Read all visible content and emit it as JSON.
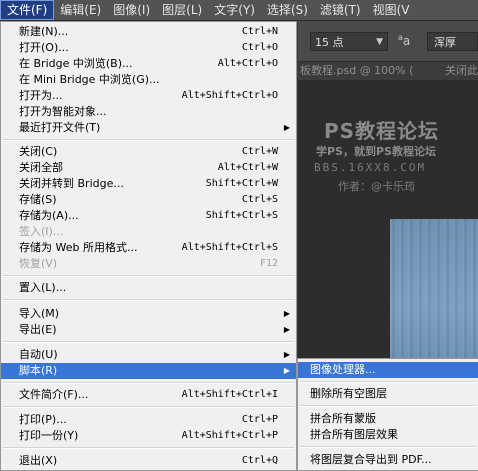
{
  "menubar": {
    "items": [
      "文件(F)",
      "编辑(E)",
      "图像(I)",
      "图层(L)",
      "文字(Y)",
      "选择(S)",
      "滤镜(T)",
      "视图(V"
    ]
  },
  "options": {
    "font_size": "15 点",
    "aa_icon": "a",
    "aa_sub": "a",
    "aa_value": "浑厚"
  },
  "doc_tab": {
    "title": "板教程.psd @ 100% (",
    "close_text": "关闭此"
  },
  "watermark": {
    "title": "PS教程论坛",
    "subtitle": "学PS，就到PS教程论坛",
    "url": "BBS.16XX8.COM",
    "author": "作者：@卡乐筠"
  },
  "file_menu": {
    "items": [
      {
        "label": "新建(N)...",
        "shortcut": "Ctrl+N"
      },
      {
        "label": "打开(O)...",
        "shortcut": "Ctrl+O"
      },
      {
        "label": "在 Bridge 中浏览(B)...",
        "shortcut": "Alt+Ctrl+O"
      },
      {
        "label": "在 Mini Bridge 中浏览(G)...",
        "shortcut": ""
      },
      {
        "label": "打开为...",
        "shortcut": "Alt+Shift+Ctrl+O"
      },
      {
        "label": "打开为智能对象...",
        "shortcut": ""
      },
      {
        "label": "最近打开文件(T)",
        "shortcut": ""
      },
      {
        "label": "关闭(C)",
        "shortcut": "Ctrl+W"
      },
      {
        "label": "关闭全部",
        "shortcut": "Alt+Ctrl+W"
      },
      {
        "label": "关闭并转到 Bridge...",
        "shortcut": "Shift+Ctrl+W"
      },
      {
        "label": "存储(S)",
        "shortcut": "Ctrl+S"
      },
      {
        "label": "存储为(A)...",
        "shortcut": "Shift+Ctrl+S"
      },
      {
        "label": "签入(I)...",
        "shortcut": ""
      },
      {
        "label": "存储为 Web 所用格式...",
        "shortcut": "Alt+Shift+Ctrl+S"
      },
      {
        "label": "恢复(V)",
        "shortcut": "F12"
      },
      {
        "label": "置入(L)...",
        "shortcut": ""
      },
      {
        "label": "导入(M)",
        "shortcut": ""
      },
      {
        "label": "导出(E)",
        "shortcut": ""
      },
      {
        "label": "自动(U)",
        "shortcut": ""
      },
      {
        "label": "脚本(R)",
        "shortcut": ""
      },
      {
        "label": "文件简介(F)...",
        "shortcut": "Alt+Shift+Ctrl+I"
      },
      {
        "label": "打印(P)...",
        "shortcut": "Ctrl+P"
      },
      {
        "label": "打印一份(Y)",
        "shortcut": "Alt+Shift+Ctrl+P"
      },
      {
        "label": "退出(X)",
        "shortcut": "Ctrl+Q"
      }
    ]
  },
  "script_submenu": {
    "items": [
      "图像处理器...",
      "删除所有空图层",
      "拼合所有蒙版",
      "拼合所有图层效果",
      "将图层复合导出到 PDF..."
    ]
  },
  "colors": {
    "menubar_bg": "#535353",
    "menu_bg": "#f0f0f0",
    "highlight": "#3875d7",
    "active_menu": "#1e3f86"
  }
}
